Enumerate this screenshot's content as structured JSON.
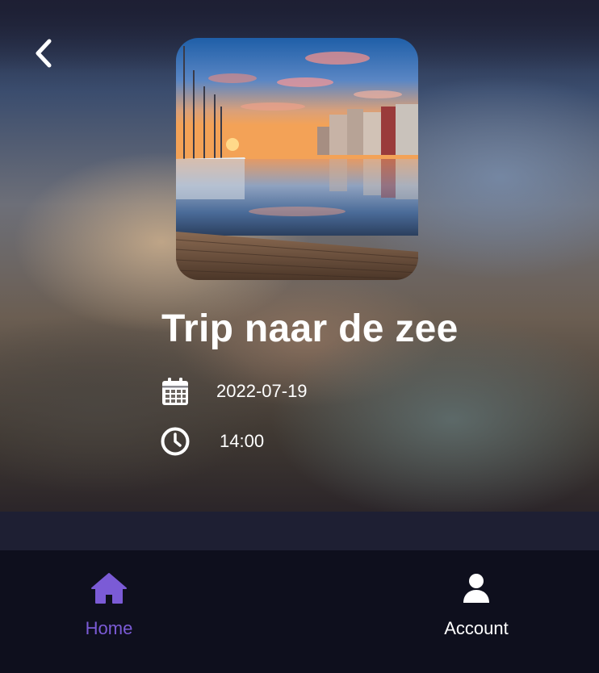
{
  "trip": {
    "title": "Trip naar de zee",
    "date": "2022-07-19",
    "time": "14:00",
    "cover_image": "harbor-sunset-photo"
  },
  "icons": {
    "back": "chevron-left-icon",
    "date": "calendar-icon",
    "time": "clock-icon",
    "home": "home-icon",
    "account": "user-icon"
  },
  "nav": {
    "items": [
      {
        "label": "Home",
        "active": true
      },
      {
        "label": "Account",
        "active": false
      }
    ]
  },
  "colors": {
    "accent": "#7b5bd6",
    "background": "#1e1f33",
    "nav_background": "#0e0f1d",
    "text": "#ffffff"
  }
}
